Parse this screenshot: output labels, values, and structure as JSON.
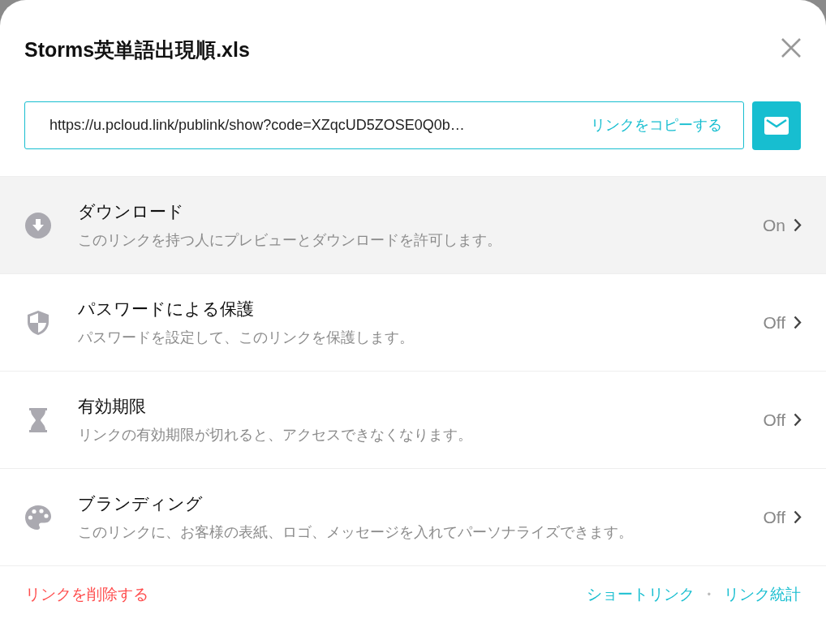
{
  "dialog": {
    "title": "Storms英単語出現順.xls"
  },
  "link": {
    "url": "https://u.pcloud.link/publink/show?code=XZqcUD5ZOSE0Q0b…",
    "copy_label": "リンクをコピーする"
  },
  "settings": [
    {
      "kind": "download",
      "title": "ダウンロード",
      "description": "このリンクを持つ人にプレビューとダウンロードを許可します。",
      "status": "On",
      "selected": true
    },
    {
      "kind": "password",
      "title": "パスワードによる保護",
      "description": "パスワードを設定して、このリンクを保護します。",
      "status": "Off",
      "selected": false
    },
    {
      "kind": "expiry",
      "title": "有効期限",
      "description": "リンクの有効期限が切れると、アクセスできなくなります。",
      "status": "Off",
      "selected": false
    },
    {
      "kind": "branding",
      "title": "ブランディング",
      "description": "このリンクに、お客様の表紙、ロゴ、メッセージを入れてパーソナライズできます。",
      "status": "Off",
      "selected": false
    }
  ],
  "footer": {
    "delete_link": "リンクを削除する",
    "short_link": "ショートリンク",
    "separator": "•",
    "stats_link": "リンク統計"
  }
}
